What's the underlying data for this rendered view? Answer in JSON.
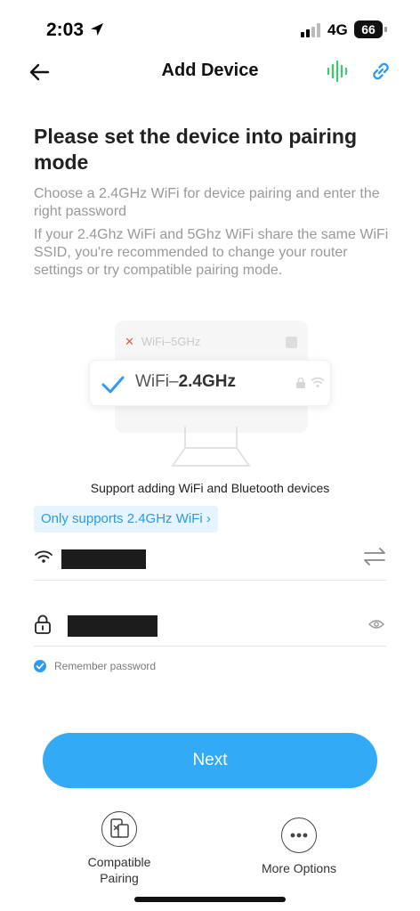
{
  "status_bar": {
    "time": "2:03",
    "network": "4G",
    "battery": "66",
    "icons": [
      "location-arrow-icon",
      "cellular-signal-icon"
    ]
  },
  "nav": {
    "title": "Add Device",
    "icons": [
      "back-arrow-icon",
      "sound-wave-icon",
      "link-icon"
    ]
  },
  "content": {
    "heading": "Please set the device into pairing mode",
    "description_1": "Choose a 2.4GHz WiFi for device pairing and enter the right password",
    "description_2": "If your 2.4Ghz WiFi and 5Ghz WiFi share the same WiFi SSID, you're recommended to change your router settings or try compatible pairing mode.",
    "illustration": {
      "ssid_5g": "WiFi–5GHz",
      "ssid_24_prefix": "WiFi–",
      "ssid_24_strong": "2.4GHz"
    },
    "support_text": "Support adding WiFi and Bluetooth devices",
    "badge": "Only supports 2.4GHz WiFi ›"
  },
  "form": {
    "wifi_icon": "wifi-icon",
    "password_icon": "lock-icon",
    "remember_label": "Remember password",
    "remember_checked": true
  },
  "actions": {
    "next_label": "Next",
    "compatible_label_1": "Compatible",
    "compatible_label_2": "Pairing",
    "more_label": "More Options"
  },
  "colors": {
    "accent": "#32aaf5",
    "badge_bg": "#e6f4fd",
    "wave_green": "#3cc86a",
    "error_red": "#e25b52"
  }
}
